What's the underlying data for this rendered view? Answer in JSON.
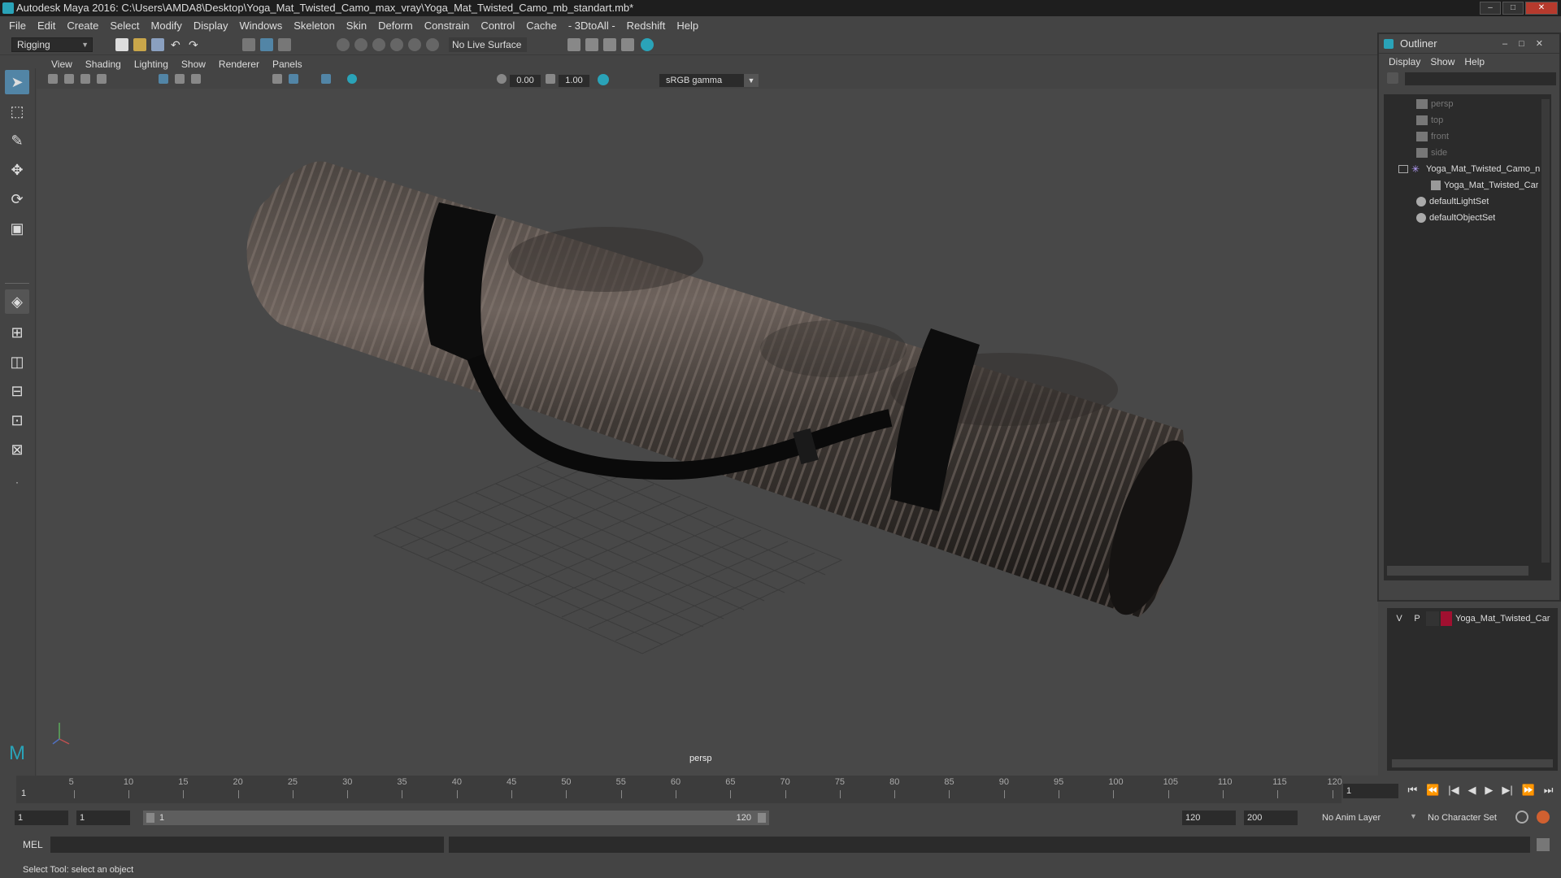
{
  "window": {
    "title": "Autodesk Maya 2016: C:\\Users\\AMDA8\\Desktop\\Yoga_Mat_Twisted_Camo_max_vray\\Yoga_Mat_Twisted_Camo_mb_standart.mb*",
    "min": "–",
    "max": "□",
    "close": "✕"
  },
  "menubar": [
    "File",
    "Edit",
    "Create",
    "Select",
    "Modify",
    "Display",
    "Windows",
    "Skeleton",
    "Skin",
    "Deform",
    "Constrain",
    "Control",
    "Cache",
    "- 3DtoAll -",
    "Redshift",
    "Help"
  ],
  "shelf": {
    "mode": "Rigging",
    "live_surface": "No Live Surface"
  },
  "viewport": {
    "menu": [
      "View",
      "Shading",
      "Lighting",
      "Show",
      "Renderer",
      "Panels"
    ],
    "exposure": "0.00",
    "gamma_value": "1.00",
    "color_space": "sRGB gamma",
    "camera_label": "persp"
  },
  "outliner": {
    "title": "Outliner",
    "menu": [
      "Display",
      "Show",
      "Help"
    ],
    "items": [
      {
        "label": "persp",
        "type": "camera"
      },
      {
        "label": "top",
        "type": "camera"
      },
      {
        "label": "front",
        "type": "camera"
      },
      {
        "label": "side",
        "type": "camera"
      },
      {
        "label": "Yoga_Mat_Twisted_Camo_n",
        "type": "group"
      },
      {
        "label": "Yoga_Mat_Twisted_Car",
        "type": "mesh"
      },
      {
        "label": "defaultLightSet",
        "type": "set"
      },
      {
        "label": "defaultObjectSet",
        "type": "set"
      }
    ]
  },
  "layers": {
    "v": "V",
    "p": "P",
    "name": "Yoga_Mat_Twisted_Car",
    "color": "#a01030"
  },
  "timeline": {
    "ticks": [
      "5",
      "10",
      "15",
      "20",
      "25",
      "30",
      "35",
      "40",
      "45",
      "50",
      "55",
      "60",
      "65",
      "70",
      "75",
      "80",
      "85",
      "90",
      "95",
      "100",
      "105",
      "110",
      "115",
      "120"
    ],
    "current_frame_marker": "1",
    "current_frame": "1"
  },
  "range": {
    "start": "1",
    "playback_start": "1",
    "slider_start": "1",
    "slider_end": "120",
    "playback_end": "120",
    "end": "200",
    "anim_layer": "No Anim Layer",
    "character_set": "No Character Set"
  },
  "cmdline": {
    "label": "MEL"
  },
  "helpline": "Select Tool: select an object",
  "colors": {
    "accent": "#5285a6",
    "maya_teal": "#2aa3b8"
  }
}
